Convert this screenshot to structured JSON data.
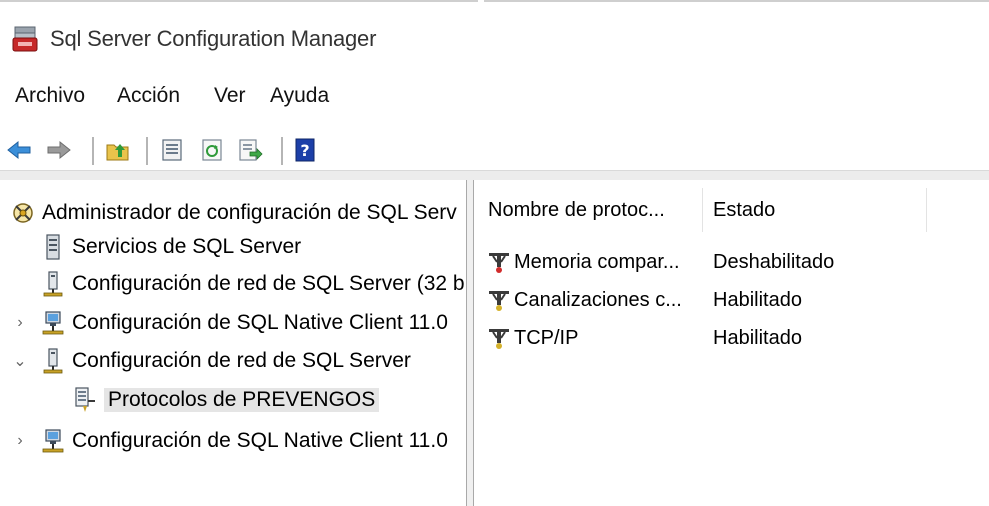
{
  "window": {
    "title": "Sql Server Configuration Manager"
  },
  "menu": [
    "Archivo",
    "Acción",
    "Ver",
    "Ayuda"
  ],
  "toolbar": [
    {
      "name": "back-icon"
    },
    {
      "name": "forward-icon"
    },
    {
      "name": "up-folder-icon"
    },
    {
      "name": "properties-icon"
    },
    {
      "name": "refresh-icon"
    },
    {
      "name": "export-list-icon"
    },
    {
      "name": "help-icon"
    }
  ],
  "tree": {
    "root": "Administrador de configuración de SQL Serv",
    "items": [
      {
        "label": "Servicios de SQL Server",
        "icon": "server-services-icon"
      },
      {
        "label": "Configuración de red de SQL Server (32 b",
        "icon": "network-config-icon"
      },
      {
        "label": "Configuración de SQL Native Client 11.0",
        "icon": "native-client-icon",
        "expander": "collapsed"
      },
      {
        "label": "Configuración de red de SQL Server",
        "icon": "network-config-icon",
        "expander": "expanded"
      },
      {
        "label": "Protocolos de PREVENGOS",
        "icon": "protocols-icon",
        "selected": true
      },
      {
        "label": "Configuración de SQL Native Client 11.0",
        "icon": "native-client-icon",
        "expander": "collapsed"
      }
    ]
  },
  "list": {
    "columns": [
      "Nombre de protoc...",
      "Estado"
    ],
    "rows": [
      {
        "name": "Memoria compar...",
        "status": "Deshabilitado"
      },
      {
        "name": "Canalizaciones c...",
        "status": "Habilitado"
      },
      {
        "name": "TCP/IP",
        "status": "Habilitado"
      }
    ]
  },
  "colors": {
    "back_arrow": "#3b8fd9",
    "forward_arrow": "#8a8a8a",
    "selection": "#e5e5e5",
    "help": "#1c3fa8"
  }
}
